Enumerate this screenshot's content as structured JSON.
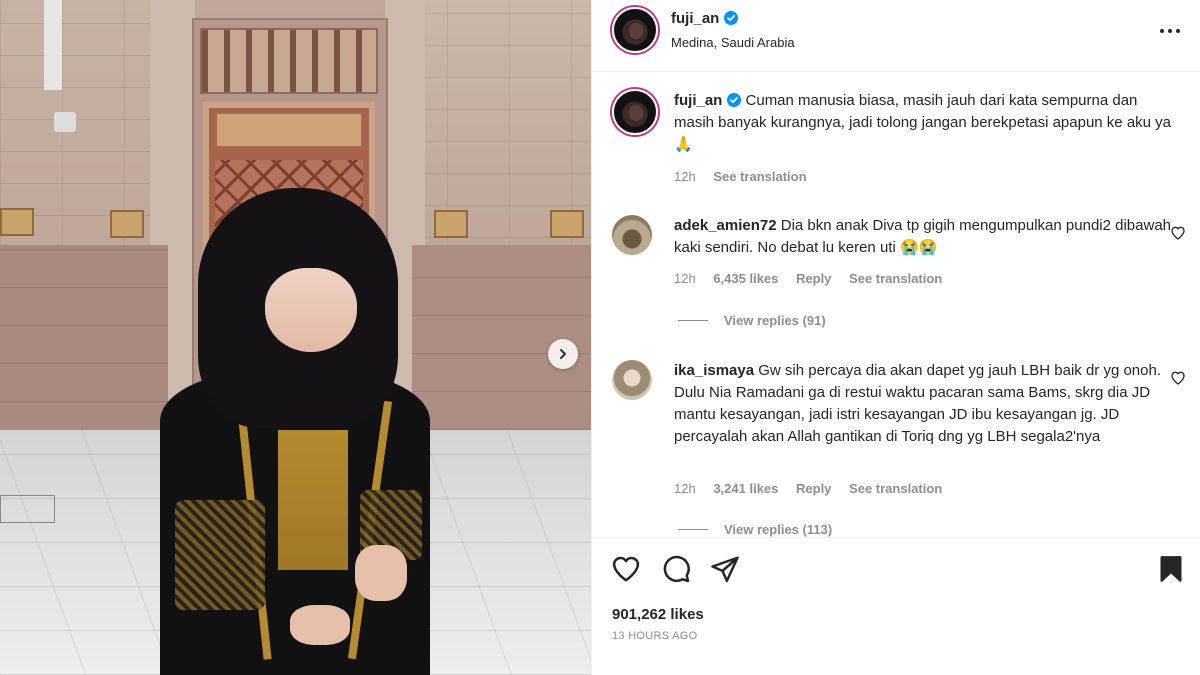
{
  "post": {
    "username": "fuji_an",
    "location": "Medina, Saudi Arabia",
    "caption": "Cuman manusia biasa, masih jauh dari kata sempurna dan masih banyak kurangnya, jadi tolong jangan berekpetasi apapun ke aku ya🙏",
    "caption_time": "12h",
    "caption_translate": "See translation"
  },
  "comments": [
    {
      "username": "adek_amien72",
      "text": "Dia bkn anak Diva tp gigih mengumpulkan pundi2 dibawah kaki sendiri. No debat lu keren uti 😭😭",
      "time": "12h",
      "likes": "6,435 likes",
      "reply": "Reply",
      "translate": "See translation",
      "view_replies": "View replies (91)"
    },
    {
      "username": "ika_ismaya",
      "text": "Gw sih percaya dia akan dapet yg jauh LBH baik dr yg onoh. Dulu Nia Ramadani ga di restui waktu pacaran sama Bams, skrg dia JD mantu kesayangan, jadi istri kesayangan JD ibu kesayangan jg. JD percayalah akan Allah gantikan di Toriq dng yg LBH segala2'nya",
      "time": "12h",
      "likes": "3,241 likes",
      "reply": "Reply",
      "translate": "See translation",
      "view_replies": "View replies (113)"
    }
  ],
  "stats": {
    "likes": "901,262 likes",
    "time_ago": "13 HOURS AGO"
  },
  "icons": {
    "verified": "verified-badge-icon",
    "more": "more-options-icon",
    "next": "chevron-right-icon",
    "like": "heart-icon",
    "comment": "comment-icon",
    "share": "paper-plane-icon",
    "save": "bookmark-icon"
  },
  "colors": {
    "verified": "#0095f6",
    "secondary_text": "#8e8e8e",
    "primary_text": "#262626"
  }
}
